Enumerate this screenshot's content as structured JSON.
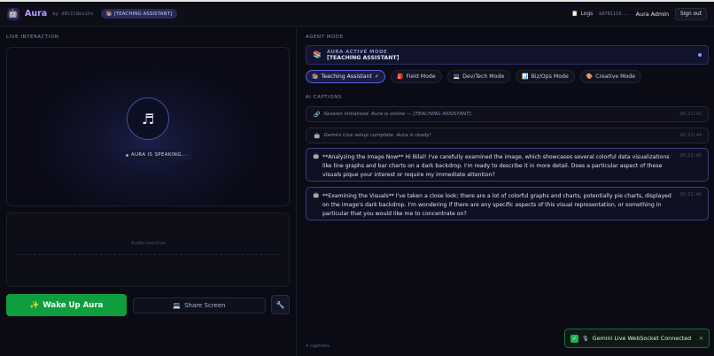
{
  "header": {
    "logo_icon": "robot-icon",
    "brand": "Aura",
    "byline": "by d8t1l8esihs",
    "mode_pill": "[TEACHING ASSISTANT]",
    "logs_label": "Logs",
    "user_id": "b0781119...",
    "user_name": "Aura Admin",
    "sign_out": "Sign out"
  },
  "left": {
    "section_label": "LIVE INTERACTION",
    "speaking_label": "AURA IS SPEAKING...",
    "audio_status": "Audio inactive",
    "wake_button": "Wake Up Aura",
    "wake_icon": "✨",
    "share_button": "Share Screen",
    "share_icon": "💻",
    "tool_icon": "wrench-icon"
  },
  "right": {
    "section_label": "AGENT MODE",
    "agent_top": "AURA ACTIVE MODE",
    "agent_bottom": "[TEACHING ASSISTANT]",
    "tabs": [
      {
        "icon": "📚",
        "label": "Teaching Assistant",
        "check": "✓",
        "active": true
      },
      {
        "icon": "🎒",
        "label": "Field Mode"
      },
      {
        "icon": "💻",
        "label": "Dev/Tech Mode"
      },
      {
        "icon": "📊",
        "label": "Biz/Ops Mode"
      },
      {
        "icon": "🎨",
        "label": "Creative Mode"
      }
    ],
    "captions_label": "AI CAPTIONS",
    "captions": [
      {
        "type": "system",
        "icon": "🔗",
        "text": "Session initialised. Aura is online — [TEACHING ASSISTANT].",
        "time": "20:21:42"
      },
      {
        "type": "system",
        "icon": "🤖",
        "text": "Gemini Live setup complete. Aura is ready!",
        "time": "20:21:44"
      },
      {
        "type": "ai",
        "icon": "🤖",
        "text": "**Analyzing the Image Now** Hi Bilal! I've carefully examined the image, which showcases several colorful data visualizations like line graphs and bar charts on a dark backdrop. I'm ready to describe it in more detail. Does a particular aspect of these visuals pique your interest or require my immediate attention?",
        "time": "20:21:45"
      },
      {
        "type": "ai",
        "icon": "🤖",
        "text": "**Examining the Visuals** I've taken a close look; there are a lot of colorful graphs and charts, potentially pie charts, displayed on the image's dark backdrop. I'm wondering if there are any specific aspects of this visual representation, or something in particular that you would like me to concentrate on?",
        "time": "20:21:46"
      }
    ],
    "count": "4 captions"
  },
  "toast": {
    "icon": "🎙",
    "text": "Gemini Live WebSocket Connected",
    "close": "✕"
  },
  "colors": {
    "accent": "#b79cff",
    "success": "#0f9e3e",
    "active_tab": "#5a63d8"
  }
}
